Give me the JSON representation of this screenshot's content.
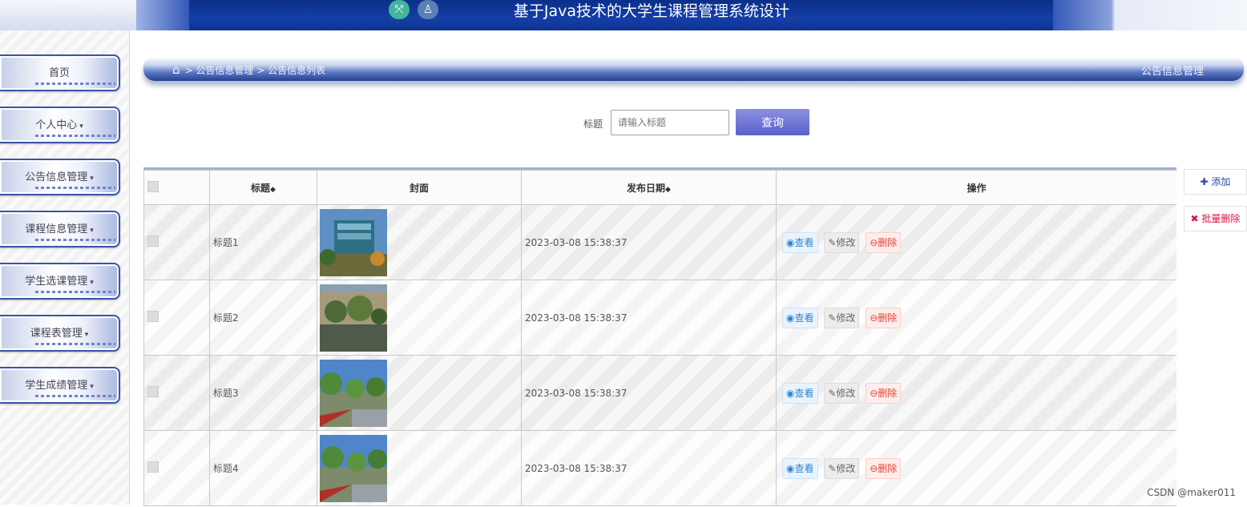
{
  "header": {
    "title": "基于Java技术的大学生课程管理系统设计"
  },
  "sidebar": {
    "items": [
      {
        "label": "首页",
        "caret": ""
      },
      {
        "label": "个人中心",
        "caret": "▾"
      },
      {
        "label": "公告信息管理",
        "caret": "▾"
      },
      {
        "label": "课程信息管理",
        "caret": "▾"
      },
      {
        "label": "学生选课管理",
        "caret": "▾"
      },
      {
        "label": "课程表管理",
        "caret": "▾"
      },
      {
        "label": "学生成绩管理",
        "caret": "▾"
      }
    ]
  },
  "breadcrumb": {
    "path": "> 公告信息管理 > 公告信息列表",
    "right": "公告信息管理"
  },
  "search": {
    "label": "标题",
    "placeholder": "请输入标题",
    "button": "查询"
  },
  "actions": {
    "add": "添加",
    "batch_delete": "批量删除"
  },
  "table": {
    "columns": [
      "标题",
      "封面",
      "发布日期",
      "操作"
    ],
    "rows": [
      {
        "title": "标题1",
        "date": "2023-03-08 15:38:37"
      },
      {
        "title": "标题2",
        "date": "2023-03-08 15:38:37"
      },
      {
        "title": "标题3",
        "date": "2023-03-08 15:38:37"
      },
      {
        "title": "标题4",
        "date": "2023-03-08 15:38:37"
      }
    ],
    "ops": {
      "view": "查看",
      "edit": "修改",
      "delete": "删除"
    }
  },
  "watermark": "CSDN @maker011"
}
